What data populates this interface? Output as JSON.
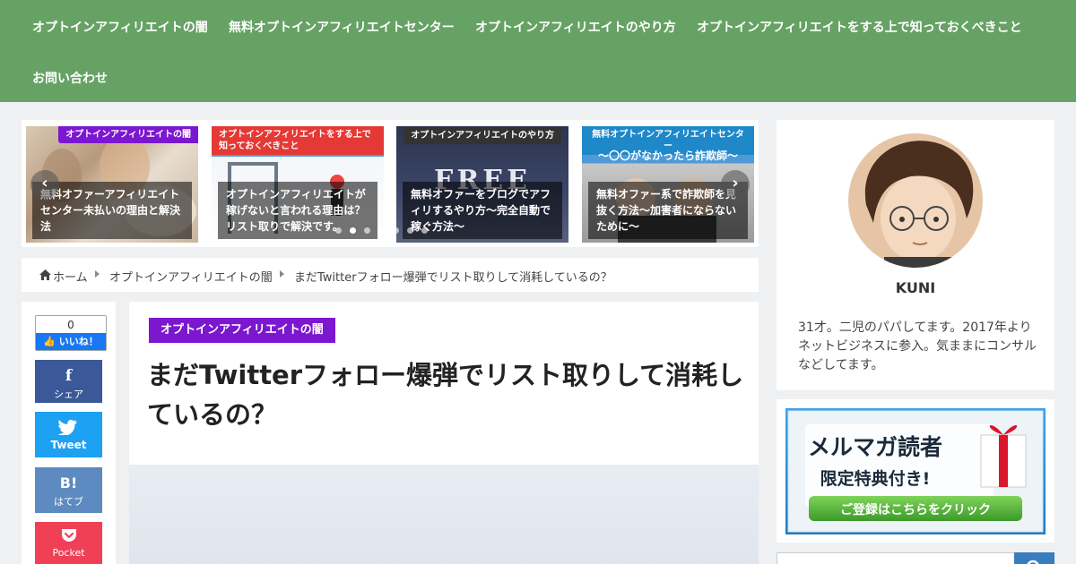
{
  "nav": {
    "items": [
      "オプトインアフィリエイトの闇",
      "無料オプトインアフィリエイトセンター",
      "オプトインアフィリエイトのやり方",
      "オプトインアフィリエイトをする上で知っておくべきこと",
      "お問い合わせ"
    ]
  },
  "carousel": {
    "slides": [
      {
        "category": "オプトインアフィリエイトの闇",
        "category_color": "#7c17d0",
        "title": "無料オファーアフィリエイトセンター未払いの理由と解決法"
      },
      {
        "category": "オプトインアフィリエイトをする上で知っておくべきこと",
        "category_color": "#e53935",
        "title": "オプトインアフィリエイトが稼げないと言われる理由は？リスト取りで解決です。"
      },
      {
        "category": "オプトインアフィリエイトのやり方",
        "category_color": "#333333",
        "title": "無料オファーをブログでアフィリするやり方〜完全自動で稼ぐ方法〜"
      },
      {
        "category": "無料オプトインアフィリエイトセンター",
        "category_color": "#1e88c9",
        "title": "無料オファー系で詐欺師を見抜く方法〜加害者にならないために〜",
        "overlay_text": "〜〇〇がなかったら詐欺師〜"
      }
    ],
    "image_text": "FREE",
    "prev_icon": "‹",
    "next_icon": "›"
  },
  "breadcrumb": {
    "home": "ホーム",
    "category": "オプトインアフィリエイトの闇",
    "current": "まだTwitterフォロー爆弾でリスト取りして消耗しているの？"
  },
  "share": {
    "like_count": "0",
    "like_label": "いいね！",
    "facebook": {
      "icon": "f",
      "label": "シェア",
      "color": "#3b5998"
    },
    "twitter": {
      "icon": "🐦",
      "label": "Tweet",
      "color": "#1da1f2"
    },
    "hatena": {
      "icon": "B!",
      "label": "はてブ",
      "color": "#5d8ac1"
    },
    "pocket": {
      "icon": "⌄",
      "label": "Pocket",
      "color": "#ef4056"
    }
  },
  "article": {
    "category": "オプトインアフィリエイトの闇",
    "title": "まだTwitterフォロー爆弾でリスト取りして消耗しているの？"
  },
  "profile": {
    "name": "KUNI",
    "description": "31才。二児のパパしてます。2017年よりネットビジネスに参入。気ままにコンサルなどしてます。"
  },
  "banner": {
    "line1": "メルマガ読者",
    "line2": "限定特典付き!",
    "cta": "ご登録はこちらをクリック"
  },
  "colors": {
    "nav_bg": "#66a264",
    "accent_purple": "#7c17d0"
  }
}
